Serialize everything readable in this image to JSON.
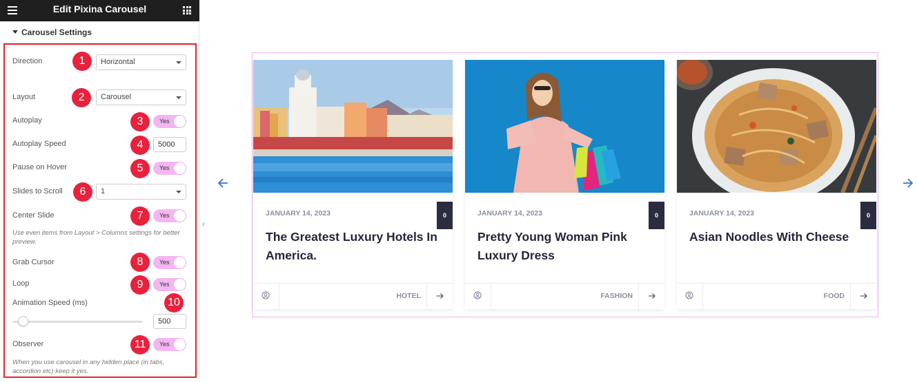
{
  "header": {
    "title": "Edit Pixina Carousel"
  },
  "section": {
    "title": "Carousel Settings"
  },
  "controls": {
    "direction": {
      "label": "Direction",
      "value": "Horizontal",
      "marker": "1"
    },
    "layout": {
      "label": "Layout",
      "value": "Carousel",
      "marker": "2"
    },
    "autoplay": {
      "label": "Autoplay",
      "value": "Yes",
      "marker": "3"
    },
    "autoplay_speed": {
      "label": "Autoplay Speed",
      "value": "5000",
      "marker": "4"
    },
    "pause_on_hover": {
      "label": "Pause on Hover",
      "value": "Yes",
      "marker": "5"
    },
    "slides_to_scroll": {
      "label": "Slides to Scroll",
      "value": "1",
      "marker": "6"
    },
    "center_slide": {
      "label": "Center Slide",
      "value": "Yes",
      "marker": "7",
      "note": "Use even items from Layout > Columns settings for better preview."
    },
    "grab_cursor": {
      "label": "Grab Cursor",
      "value": "Yes",
      "marker": "8"
    },
    "loop": {
      "label": "Loop",
      "value": "Yes",
      "marker": "9"
    },
    "animation_speed": {
      "label": "Animation Speed (ms)",
      "value": "500",
      "marker": "10",
      "level": 0.05
    },
    "observer": {
      "label": "Observer",
      "value": "Yes",
      "marker": "11",
      "note": "When you use carousel in any hidden place (in tabs, accordion etc) keep it yes."
    }
  },
  "colors": {
    "marker": "#e8213c",
    "toggle_on": "#f3b6f2",
    "frame_border": "#f0b2ef",
    "count_badge": "#2b2c40",
    "arrow": "#3b6fd0"
  },
  "cards": [
    {
      "date": "JANUARY 14, 2023",
      "count": "0",
      "title": "The Greatest Luxury Hotels In America.",
      "category": "HOTEL",
      "image": "hotel-pool-photo"
    },
    {
      "date": "JANUARY 14, 2023",
      "count": "0",
      "title": "Pretty Young Woman Pink Luxury Dress",
      "category": "FASHION",
      "image": "woman-shopping-bags-photo"
    },
    {
      "date": "JANUARY 14, 2023",
      "count": "0",
      "title": "Asian Noodles With Cheese",
      "category": "FOOD",
      "image": "noodles-bowl-photo"
    }
  ],
  "icons": {
    "prev": "arrow-left-icon",
    "next": "arrow-right-icon",
    "author": "user-circle-icon",
    "read_more": "arrow-right-icon"
  }
}
